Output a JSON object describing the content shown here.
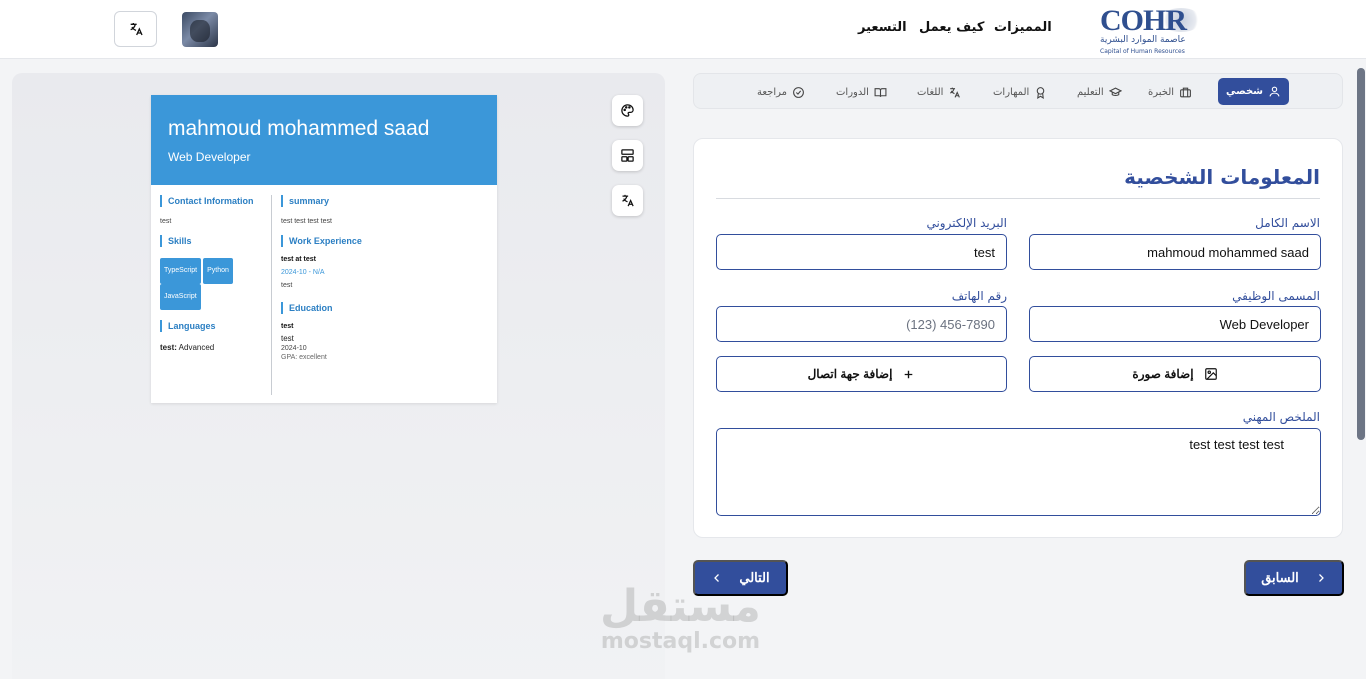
{
  "header": {
    "nav": [
      "المميزات",
      "كيف يعمل",
      "التسعير"
    ],
    "logo": {
      "abbr": "COHR",
      "arabic": "عاصمة الموارد البشرية",
      "english": "Capital of Human Resources"
    }
  },
  "steps": [
    {
      "label": "شخصي",
      "icon": "user-icon",
      "active": true
    },
    {
      "label": "الخبرة",
      "icon": "briefcase-icon"
    },
    {
      "label": "التعليم",
      "icon": "graduation-cap-icon"
    },
    {
      "label": "المهارات",
      "icon": "award-icon"
    },
    {
      "label": "اللغات",
      "icon": "translate-icon"
    },
    {
      "label": "الدورات",
      "icon": "book-icon"
    },
    {
      "label": "مراجعة",
      "icon": "check-circle-icon"
    }
  ],
  "form": {
    "title": "المعلومات الشخصية",
    "full_name": {
      "label": "الاسم الكامل",
      "value": "mahmoud mohammed saad"
    },
    "email": {
      "label": "البريد الإلكتروني",
      "value": "test"
    },
    "job_title": {
      "label": "المسمى الوظيفي",
      "value": "Web Developer"
    },
    "phone": {
      "label": "رقم الهاتف",
      "value": "",
      "placeholder": "(123) 456-7890"
    },
    "add_photo": "إضافة صورة",
    "add_contact": "إضافة جهة اتصال",
    "summary": {
      "label": "الملخص المهني",
      "value": "test test test test"
    }
  },
  "nav_buttons": {
    "previous": "السابق",
    "next": "التالي"
  },
  "cv": {
    "name": "mahmoud mohammed saad",
    "title": "Web Developer",
    "contact_heading": "Contact Information",
    "contact_value": "test",
    "skills_heading": "Skills",
    "skills": [
      "TypeScript",
      "Python",
      "JavaScript"
    ],
    "languages_heading": "Languages",
    "language_name": "test:",
    "language_level": "Advanced",
    "summary_heading": "summary",
    "summary_text": "test test test test",
    "experience_heading": "Work Experience",
    "exp_role": "test at test",
    "exp_dates": "2024-10 - N/A",
    "exp_desc": "test",
    "education_heading": "Education",
    "edu_school": "test",
    "edu_degree": "test",
    "edu_date": "2024-10",
    "edu_gpa": "GPA: excellent"
  },
  "watermark": {
    "arabic": "مستقل",
    "latin": "mostaql.com"
  },
  "colors": {
    "primary": "#324e9c",
    "cv_accent": "#3b97d9"
  }
}
